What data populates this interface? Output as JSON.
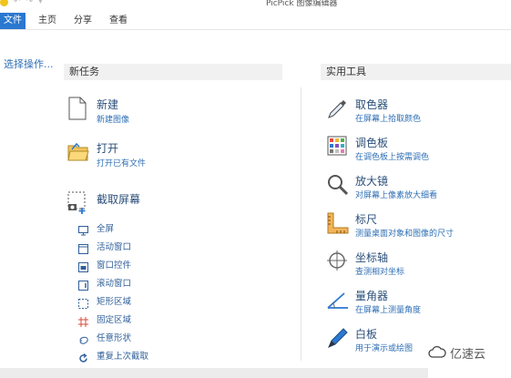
{
  "window": {
    "title": "PicPick 图像编辑器"
  },
  "ribbon": {
    "tabs": [
      "文件",
      "主页",
      "分享",
      "查看"
    ]
  },
  "left_pane": {
    "link": "选择操作..."
  },
  "new_task": {
    "header": "新任务",
    "new": {
      "title": "新建",
      "subtitle": "新建图像"
    },
    "open": {
      "title": "打开",
      "subtitle": "打开已有文件"
    },
    "capture": {
      "title": "截取屏幕",
      "items": [
        "全屏",
        "活动窗口",
        "窗口控件",
        "滚动窗口",
        "矩形区域",
        "固定区域",
        "任意形状",
        "重复上次截取"
      ]
    }
  },
  "tools": {
    "header": "实用工具",
    "items": [
      {
        "title": "取色器",
        "subtitle": "在屏幕上拾取颜色"
      },
      {
        "title": "调色板",
        "subtitle": "在调色板上按需调色"
      },
      {
        "title": "放大镜",
        "subtitle": "对屏幕上像素放大细看"
      },
      {
        "title": "标尺",
        "subtitle": "测量桌面对象和图像的尺寸"
      },
      {
        "title": "坐标轴",
        "subtitle": "查测相对坐标"
      },
      {
        "title": "量角器",
        "subtitle": "在屏幕上测量角度"
      },
      {
        "title": "白板",
        "subtitle": "用于演示或绘图"
      }
    ]
  },
  "watermark": {
    "text": "亿速云"
  },
  "colors": {
    "accent": "#2b78d0",
    "link": "#2f6fb5",
    "title_blue": "#2b4f7a",
    "section_bg": "#f1f1f1"
  }
}
